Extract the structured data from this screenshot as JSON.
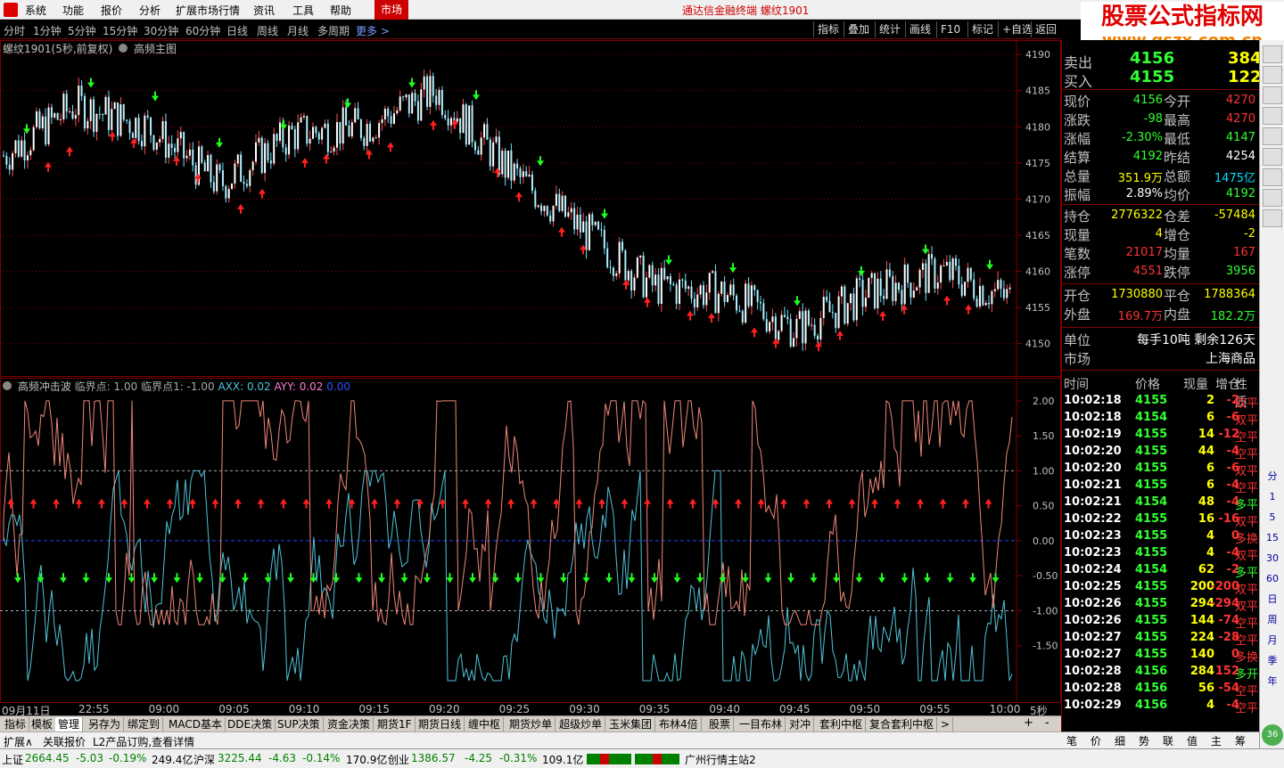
{
  "menu": {
    "items": [
      "系统",
      "功能",
      "报价",
      "分析",
      "扩展市场行情",
      "资讯",
      "工具",
      "帮助"
    ],
    "market": "市场",
    "app_title": "通达信金融终端  螺纹1901"
  },
  "watermark": {
    "line1": "股票公式指标网",
    "line2": "www.gszx.com.cn"
  },
  "periods": [
    "分时",
    "1分钟",
    "5分钟",
    "15分钟",
    "30分钟",
    "60分钟",
    "日线",
    "周线",
    "月线",
    "多周期",
    "更多 >"
  ],
  "toolbar": [
    "指标",
    "叠加",
    "统计",
    "画线",
    "F10",
    "标记",
    "+自选",
    "返回"
  ],
  "main_chart": {
    "title": "螺纹1901(5秒,前复权)",
    "subtitle": "高频主图"
  },
  "sub_chart": {
    "title": "高频冲击波",
    "params": "临界点: 1.00  临界点1: -1.00",
    "axx": "AXX: 0.02",
    "ayy": "AYY: 0.02",
    "last": "0.00"
  },
  "time_axis": {
    "date": "09月11日",
    "labels": [
      "22:55",
      "09:00",
      "09:05",
      "09:10",
      "09:15",
      "09:20",
      "09:25",
      "09:30",
      "09:35",
      "09:40",
      "09:45",
      "09:50",
      "09:55",
      "10:00"
    ],
    "period": "5秒"
  },
  "chart_data": [
    {
      "type": "line",
      "title": "螺纹1901(5秒,前复权) 高频主图",
      "ylim": [
        4147,
        4191
      ],
      "yticks": [
        4150,
        4155,
        4160,
        4165,
        4170,
        4175,
        4180,
        4185,
        4190
      ],
      "x": [
        "22:55",
        "09:00",
        "09:05",
        "09:10",
        "09:15",
        "09:20",
        "09:25",
        "09:30",
        "09:35",
        "09:40",
        "09:45",
        "09:50",
        "09:55",
        "10:00"
      ],
      "series": [
        {
          "values": [
            4176,
            4183,
            4180,
            4172,
            4179,
            4180,
            4185,
            4174,
            4166,
            4158,
            4157,
            4152,
            4157,
            4160,
            4156
          ]
        }
      ]
    },
    {
      "type": "line",
      "title": "高频冲击波",
      "ylim": [
        -2.0,
        2.1
      ],
      "yticks": [
        2.0,
        1.5,
        1.0,
        0.5,
        0.0,
        -0.5,
        -1.0,
        -1.5
      ],
      "thresholds": [
        1.0,
        -1.0
      ]
    }
  ],
  "quote": {
    "sell_label": "卖出",
    "sell_price": "4156",
    "sell_vol": "384",
    "buy_label": "买入",
    "buy_price": "4155",
    "buy_vol": "122",
    "rows": [
      {
        "l1": "现价",
        "v1": "4156",
        "l2": "今开",
        "v2": "4270",
        "c1": "grn",
        "c2": "red"
      },
      {
        "l1": "涨跌",
        "v1": "-98",
        "l2": "最高",
        "v2": "4270",
        "c1": "grn",
        "c2": "red"
      },
      {
        "l1": "涨幅",
        "v1": "-2.30%",
        "l2": "最低",
        "v2": "4147",
        "c1": "grn",
        "c2": "grn"
      },
      {
        "l1": "结算",
        "v1": "4192",
        "l2": "昨结",
        "v2": "4254",
        "c1": "grn",
        "c2": "wht"
      },
      {
        "l1": "总量",
        "v1": "351.9万",
        "l2": "总额",
        "v2": "1475亿",
        "c1": "yel",
        "c2": "cyn"
      },
      {
        "l1": "振幅",
        "v1": "2.89%",
        "l2": "均价",
        "v2": "4192",
        "c1": "wht",
        "c2": "grn"
      }
    ],
    "rows2": [
      {
        "l1": "持仓",
        "v1": "2776322",
        "l2": "仓差",
        "v2": "-57484",
        "c1": "yel",
        "c2": "yel"
      },
      {
        "l1": "现量",
        "v1": "4",
        "l2": "增仓",
        "v2": "-2",
        "c1": "yel",
        "c2": "yel"
      },
      {
        "l1": "笔数",
        "v1": "21017",
        "l2": "均量",
        "v2": "167",
        "c1": "red",
        "c2": "red"
      },
      {
        "l1": "涨停",
        "v1": "4551",
        "l2": "跌停",
        "v2": "3956",
        "c1": "red",
        "c2": "grn"
      }
    ],
    "rows3": [
      {
        "l1": "开仓",
        "v1": "1730880",
        "l2": "平仓",
        "v2": "1788364",
        "c1": "yel",
        "c2": "yel"
      },
      {
        "l1": "外盘",
        "v1": "169.7万",
        "l2": "内盘",
        "v2": "182.2万",
        "c1": "red",
        "c2": "grn"
      }
    ],
    "unit_label": "单位",
    "unit_value": "每手10吨  剩余126天",
    "market_label": "市场",
    "market_value": "上海商品"
  },
  "ticks": {
    "headers": [
      "时间",
      "价格",
      "现量",
      "增仓",
      "性质"
    ],
    "rows": [
      [
        "10:02:18",
        "4155",
        "2",
        "-2",
        "双平"
      ],
      [
        "10:02:18",
        "4154",
        "6",
        "-6",
        "双平"
      ],
      [
        "10:02:19",
        "4155",
        "14",
        "-12",
        "空平"
      ],
      [
        "10:02:20",
        "4155",
        "44",
        "-4",
        "空平"
      ],
      [
        "10:02:20",
        "4155",
        "6",
        "-6",
        "双平"
      ],
      [
        "10:02:21",
        "4155",
        "6",
        "-4",
        "空平"
      ],
      [
        "10:02:21",
        "4154",
        "48",
        "-4",
        "多平"
      ],
      [
        "10:02:22",
        "4155",
        "16",
        "-16",
        "双平"
      ],
      [
        "10:02:23",
        "4155",
        "4",
        "0",
        "多换"
      ],
      [
        "10:02:23",
        "4155",
        "4",
        "-4",
        "双平"
      ],
      [
        "10:02:24",
        "4154",
        "62",
        "-2",
        "多平"
      ],
      [
        "10:02:25",
        "4155",
        "200",
        "-200",
        "双平"
      ],
      [
        "10:02:26",
        "4155",
        "294",
        "-294",
        "双平"
      ],
      [
        "10:02:26",
        "4155",
        "144",
        "-74",
        "空平"
      ],
      [
        "10:02:27",
        "4155",
        "224",
        "-28",
        "空平"
      ],
      [
        "10:02:27",
        "4155",
        "140",
        "0",
        "多换"
      ],
      [
        "10:02:28",
        "4156",
        "284",
        "152",
        "多开"
      ],
      [
        "10:02:28",
        "4156",
        "56",
        "-54",
        "空平"
      ],
      [
        "10:02:29",
        "4156",
        "4",
        "-4",
        "空平"
      ]
    ]
  },
  "tabs": [
    "指标",
    "模板",
    "管理",
    "另存为",
    "绑定到",
    "MACD基本",
    "DDE决策",
    "SUP决策",
    "资金决策",
    "期货1F",
    "期货日线",
    "缠中枢",
    "期货炒单",
    "超级炒单",
    "玉米集团",
    "布林4倍",
    "股票",
    "一目布林",
    "对冲",
    "套利中枢",
    "复合套利中枢",
    ">"
  ],
  "links": [
    "扩展∧",
    "关联报价",
    "L2产品订购,查看详情"
  ],
  "bottom_tabs": [
    "笔",
    "价",
    "细",
    "势",
    "联",
    "值",
    "主",
    "筹"
  ],
  "status": {
    "sh_label": "上证",
    "sh_val": "2664.45",
    "sh_chg": "-5.03",
    "sh_pct": "-0.19%",
    "sh_amt": "249.4亿",
    "sz_label": "沪深",
    "sz_val": "3225.44",
    "sz_chg": "-4.63",
    "sz_pct": "-0.14%",
    "sz_amt": "170.9亿",
    "cy_label": "创业",
    "cy_val": "1386.57",
    "cy_chg": "-4.25",
    "cy_pct": "-0.31%",
    "cy_amt": "109.1亿",
    "station": "广州行情主站2"
  },
  "sidebar": [
    "分",
    "1",
    "5",
    "15",
    "30",
    "60",
    "日",
    "周",
    "月",
    "季",
    "年"
  ],
  "colors": {
    "up": "#ff3232",
    "down": "#32ff32",
    "frame": "#800000",
    "cyan_line": "#4fc3d8",
    "salmon_line": "#f08878"
  }
}
